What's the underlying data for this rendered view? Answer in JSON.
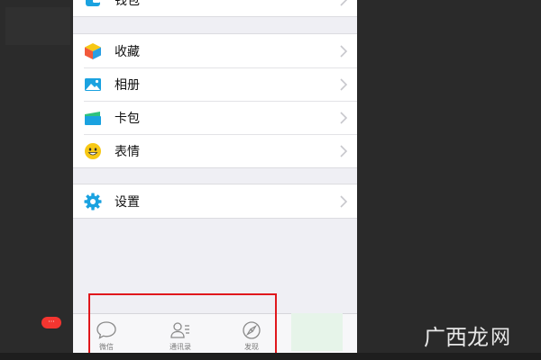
{
  "menu_groups": [
    {
      "items": [
        {
          "label": "钱包",
          "icon": "wallet-icon"
        }
      ]
    },
    {
      "items": [
        {
          "label": "收藏",
          "icon": "favorites-cube-icon"
        },
        {
          "label": "相册",
          "icon": "album-photo-icon"
        },
        {
          "label": "卡包",
          "icon": "card-package-icon"
        },
        {
          "label": "表情",
          "icon": "emoji-smile-icon"
        }
      ]
    },
    {
      "items": [
        {
          "label": "设置",
          "icon": "settings-gear-icon"
        }
      ]
    }
  ],
  "tabbar": {
    "tabs": [
      {
        "label": "微信",
        "icon": "chat-bubble-icon"
      },
      {
        "label": "通讯录",
        "icon": "contacts-icon"
      },
      {
        "label": "发现",
        "icon": "compass-icon"
      }
    ],
    "badge": "···"
  },
  "watermark": {
    "text": "广西龙",
    "tld": "网"
  },
  "colors": {
    "accent_blue": "#1aa2e0",
    "badge_red": "#f43530",
    "highlight_red": "#e0171c",
    "emoji_yellow": "#f7c815",
    "card_green": "#2ec27e"
  }
}
